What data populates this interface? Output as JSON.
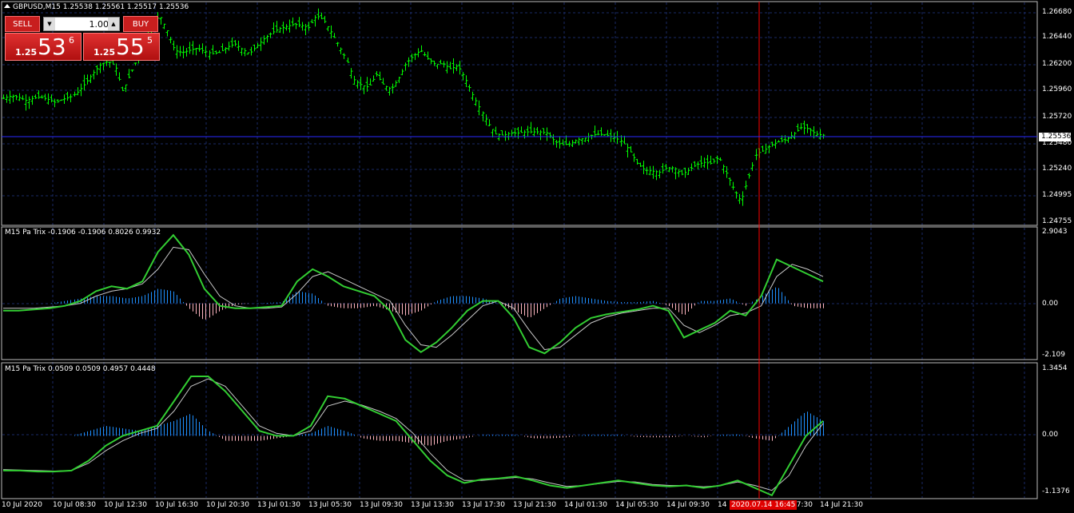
{
  "header": {
    "symbol_info": "GBPUSD,M15  1.25538 1.25561 1.25517 1.25536"
  },
  "trade_panel": {
    "sell_label": "SELL",
    "buy_label": "BUY",
    "lot_value": "1.00",
    "sell_quote": {
      "prefix": "1.25",
      "big": "53",
      "sup": "6"
    },
    "buy_quote": {
      "prefix": "1.25",
      "big": "55",
      "sup": "5"
    }
  },
  "price_axis": {
    "ticks": [
      "1.26680",
      "1.26440",
      "1.26200",
      "1.25960",
      "1.25720",
      "1.25480",
      "1.25240",
      "1.24995",
      "1.24755"
    ],
    "current_price": "1.25536"
  },
  "indicator1": {
    "label": "M15 Pa Trix -0.1906 -0.1906 0.8026 0.9932",
    "ticks": [
      "2.9043",
      "0.00",
      "-2.109"
    ]
  },
  "indicator2": {
    "label": "M15 Pa Trix 0.0509 0.0509 0.4957 0.4448",
    "ticks": [
      "1.3454",
      "0.00",
      "-1.1376"
    ]
  },
  "time_axis": {
    "ticks": [
      "10 Jul 2020",
      "10 Jul 08:30",
      "10 Jul 12:30",
      "10 Jul 16:30",
      "10 Jul 20:30",
      "13 Jul 01:30",
      "13 Jul 05:30",
      "13 Jul 09:30",
      "13 Jul 13:30",
      "13 Jul 17:30",
      "13 Jul 21:30",
      "14 Jul 01:30",
      "14 Jul 05:30",
      "14 Jul 09:30",
      "14",
      "17:30",
      "14 Jul 21:30"
    ],
    "crosshair_time": "2020.07.14 16:45"
  },
  "colors": {
    "bars": "#00ff00",
    "grid": "#1a2a66",
    "crosshair": "#ff0000",
    "line_fast": "#32cd32",
    "line_slow": "#c8c8c8",
    "hist_pos": "#1e90ff",
    "hist_neg": "#ffb6c1"
  },
  "chart_data": {
    "type": "ohlc",
    "main_close_path": [
      1.2588,
      1.259,
      1.2589,
      1.2586,
      1.2588,
      1.2589,
      1.2587,
      1.2584,
      1.2587,
      1.2589,
      1.2594,
      1.2602,
      1.2611,
      1.2619,
      1.2622,
      1.2618,
      1.2594,
      1.261,
      1.2625,
      1.264,
      1.2656,
      1.2664,
      1.265,
      1.2632,
      1.263,
      1.2632,
      1.2634,
      1.2631,
      1.2629,
      1.263,
      1.2635,
      1.2638,
      1.2633,
      1.2629,
      1.2636,
      1.2643,
      1.2648,
      1.2652,
      1.2654,
      1.2656,
      1.2655,
      1.2653,
      1.2664,
      1.266,
      1.2649,
      1.2637,
      1.2624,
      1.2605,
      1.26,
      1.2598,
      1.261,
      1.26,
      1.2596,
      1.2606,
      1.262,
      1.2627,
      1.2632,
      1.2624,
      1.2619,
      1.262,
      1.2615,
      1.2618,
      1.2606,
      1.2591,
      1.2578,
      1.2565,
      1.2555,
      1.2554,
      1.2556,
      1.2556,
      1.2557,
      1.2557,
      1.2557,
      1.2556,
      1.2548,
      1.2545,
      1.2546,
      1.255,
      1.2551,
      1.2554,
      1.2555,
      1.2554,
      1.2552,
      1.2548,
      1.254,
      1.2528,
      1.2522,
      1.2521,
      1.252,
      1.2524,
      1.2524,
      1.2518,
      1.2522,
      1.2527,
      1.2529,
      1.2528,
      1.2534,
      1.252,
      1.2505,
      1.2493,
      1.2515,
      1.2537,
      1.254,
      1.2545,
      1.2548,
      1.255,
      1.2555,
      1.2561,
      1.256,
      1.2555,
      1.2554
    ],
    "ind1": {
      "ylim": [
        -2.109,
        2.9043
      ],
      "fast": [
        -0.3,
        -0.3,
        -0.25,
        -0.2,
        -0.1,
        0.1,
        0.5,
        0.7,
        0.6,
        0.9,
        2.1,
        2.8,
        2.0,
        0.6,
        -0.1,
        -0.2,
        -0.2,
        -0.15,
        -0.1,
        0.9,
        1.4,
        1.1,
        0.7,
        0.5,
        0.3,
        -0.3,
        -1.5,
        -2.0,
        -1.6,
        -1.0,
        -0.3,
        0.1,
        0.1,
        -0.6,
        -1.8,
        -2.05,
        -1.6,
        -1.0,
        -0.6,
        -0.45,
        -0.35,
        -0.25,
        -0.1,
        -0.3,
        -1.4,
        -1.1,
        -0.8,
        -0.3,
        -0.5,
        0.3,
        1.8,
        1.5,
        1.2,
        0.9
      ],
      "slow": [
        -0.2,
        -0.2,
        -0.2,
        -0.15,
        -0.1,
        0.0,
        0.3,
        0.5,
        0.6,
        0.8,
        1.4,
        2.3,
        2.2,
        1.2,
        0.3,
        -0.1,
        -0.2,
        -0.2,
        -0.15,
        0.4,
        1.1,
        1.3,
        1.0,
        0.7,
        0.4,
        0.1,
        -0.9,
        -1.7,
        -1.8,
        -1.3,
        -0.7,
        -0.1,
        0.1,
        -0.2,
        -1.1,
        -1.9,
        -1.8,
        -1.3,
        -0.8,
        -0.55,
        -0.4,
        -0.3,
        -0.2,
        -0.2,
        -0.9,
        -1.2,
        -0.9,
        -0.5,
        -0.4,
        -0.1,
        1.1,
        1.6,
        1.4,
        1.1
      ],
      "hist": [
        0.0,
        0.0,
        0.0,
        0.0,
        0.1,
        0.2,
        0.3,
        0.3,
        0.2,
        0.3,
        0.6,
        0.5,
        -0.2,
        -0.7,
        -0.3,
        -0.05,
        0.0,
        0.02,
        0.05,
        0.5,
        0.4,
        -0.1,
        -0.2,
        -0.2,
        -0.1,
        -0.3,
        -0.5,
        -0.3,
        0.1,
        0.3,
        0.3,
        0.2,
        0.0,
        -0.3,
        -0.6,
        -0.2,
        0.2,
        0.3,
        0.2,
        0.1,
        0.05,
        0.05,
        0.1,
        -0.1,
        -0.5,
        0.1,
        0.1,
        0.2,
        -0.1,
        0.3,
        0.7,
        -0.1,
        -0.2,
        -0.2
      ]
    },
    "ind2": {
      "ylim": [
        -1.1376,
        1.3454
      ],
      "fast": [
        -0.7,
        -0.7,
        -0.72,
        -0.72,
        -0.7,
        -0.5,
        -0.2,
        0.0,
        0.1,
        0.2,
        0.7,
        1.2,
        1.2,
        0.9,
        0.5,
        0.1,
        0.0,
        0.0,
        0.2,
        0.8,
        0.75,
        0.6,
        0.45,
        0.3,
        -0.1,
        -0.5,
        -0.8,
        -0.95,
        -0.88,
        -0.86,
        -0.82,
        -0.9,
        -1.0,
        -1.05,
        -1.0,
        -0.95,
        -0.9,
        -0.95,
        -1.0,
        -1.02,
        -1.0,
        -1.05,
        -1.0,
        -0.9,
        -1.05,
        -1.2,
        -0.6,
        0.0,
        0.3
      ],
      "slow": [
        -0.68,
        -0.69,
        -0.7,
        -0.71,
        -0.7,
        -0.55,
        -0.3,
        -0.1,
        0.05,
        0.15,
        0.5,
        1.0,
        1.15,
        1.0,
        0.6,
        0.2,
        0.05,
        0.0,
        0.1,
        0.6,
        0.7,
        0.62,
        0.5,
        0.35,
        0.05,
        -0.35,
        -0.7,
        -0.9,
        -0.9,
        -0.87,
        -0.84,
        -0.87,
        -0.95,
        -1.02,
        -1.0,
        -0.96,
        -0.92,
        -0.93,
        -0.98,
        -1.0,
        -1.0,
        -1.03,
        -1.0,
        -0.93,
        -1.0,
        -1.1,
        -0.8,
        -0.2,
        0.25
      ],
      "hist": [
        0.0,
        0.0,
        0.0,
        0.0,
        0.0,
        0.1,
        0.2,
        0.15,
        0.1,
        0.2,
        0.3,
        0.45,
        0.1,
        -0.1,
        -0.1,
        -0.1,
        -0.05,
        0.0,
        0.05,
        0.2,
        0.1,
        -0.05,
        -0.1,
        -0.1,
        -0.15,
        -0.2,
        -0.1,
        -0.05,
        0.02,
        0.02,
        0.02,
        -0.05,
        -0.05,
        -0.03,
        0.02,
        0.02,
        0.02,
        -0.02,
        -0.03,
        -0.03,
        0.0,
        -0.03,
        0.02,
        0.03,
        -0.05,
        -0.1,
        0.2,
        0.5,
        0.3
      ]
    }
  }
}
